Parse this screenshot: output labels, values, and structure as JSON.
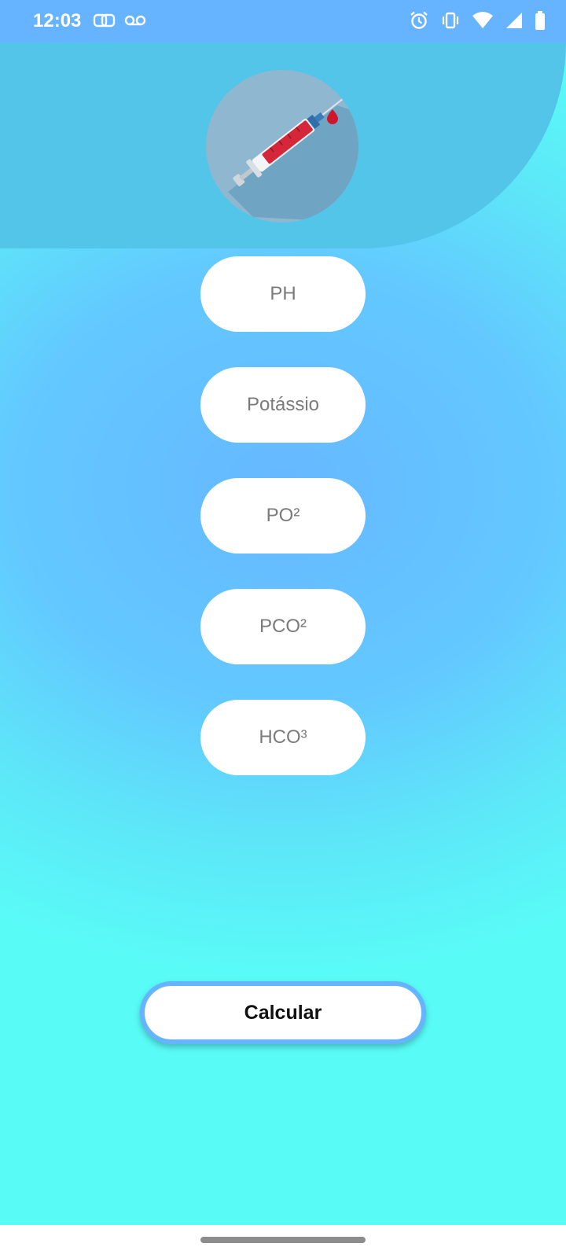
{
  "status_bar": {
    "time": "12:03",
    "left_icons": [
      "dual-sim-icon",
      "voicemail-icon"
    ],
    "right_icons": [
      "alarm-icon",
      "vibrate-icon",
      "wifi-icon",
      "signal-icon",
      "battery-icon"
    ]
  },
  "header": {
    "logo_icon": "syringe-icon"
  },
  "fields": [
    {
      "placeholder": "PH"
    },
    {
      "placeholder": "Potássio"
    },
    {
      "placeholder": "PO²"
    },
    {
      "placeholder": "PCO²"
    },
    {
      "placeholder": "HCO³"
    }
  ],
  "actions": {
    "calculate_label": "Calcular"
  },
  "colors": {
    "status_bar": "#66b3ff",
    "header": "#52c5e8",
    "field_background": "#ffffff",
    "placeholder_text": "#7b7b7b",
    "button_border": "#66b3ff"
  }
}
